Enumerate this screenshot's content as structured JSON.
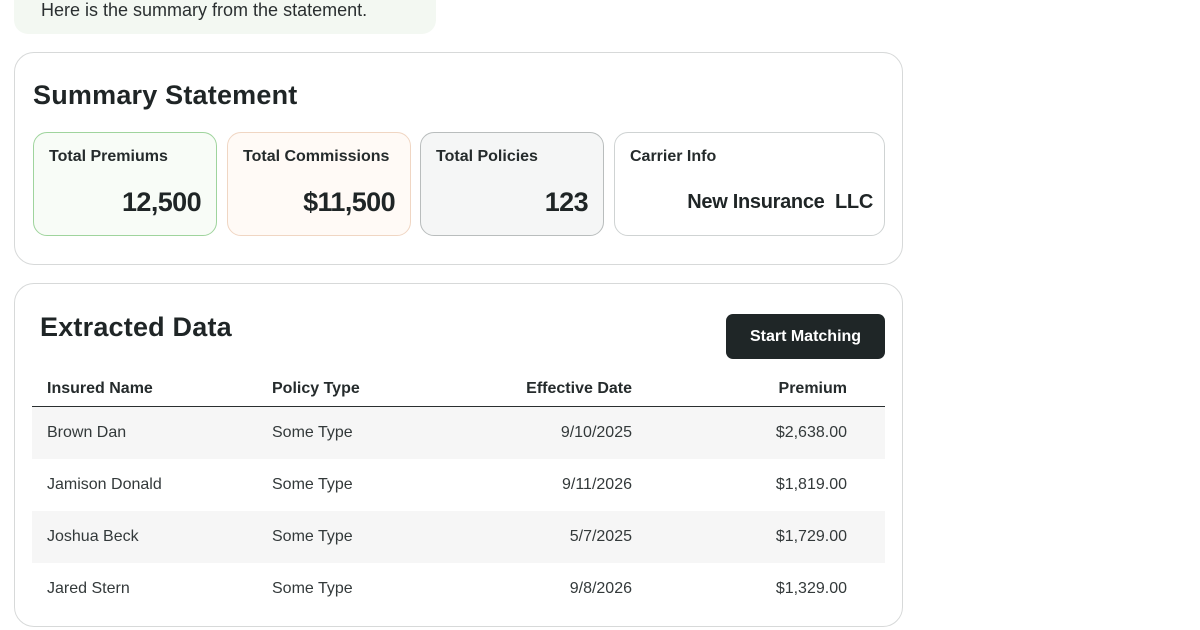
{
  "chat": {
    "message": "Here is the summary from the statement."
  },
  "summary": {
    "title": "Summary Statement",
    "stats": {
      "premiums": {
        "label": "Total Premiums",
        "value": "12,500"
      },
      "commissions": {
        "label": "Total Commissions",
        "value": "$11,500"
      },
      "policies": {
        "label": "Total Policies",
        "value": "123"
      },
      "carrier": {
        "label": "Carrier Info",
        "value": "New Insurance  LLC"
      }
    }
  },
  "extracted": {
    "title": "Extracted Data",
    "start_button": "Start Matching",
    "columns": {
      "name": "Insured Name",
      "type": "Policy Type",
      "date": "Effective Date",
      "premium": "Premium"
    },
    "rows": [
      {
        "name": "Brown Dan",
        "type": "Some Type",
        "date": "9/10/2025",
        "premium": "$2,638.00"
      },
      {
        "name": "Jamison Donald",
        "type": "Some Type",
        "date": "9/11/2026",
        "premium": "$1,819.00"
      },
      {
        "name": "Joshua Beck",
        "type": "Some Type",
        "date": "5/7/2025",
        "premium": "$1,729.00"
      },
      {
        "name": "Jared Stern",
        "type": "Some Type",
        "date": "9/8/2026",
        "premium": "$1,329.00"
      }
    ]
  },
  "colors": {
    "button_bg": "#1f2627",
    "premiums_border": "#9fd49d",
    "commissions_border": "#f0d6c3",
    "policies_border": "#b9bdbd",
    "chat_bg": "#f3f8f2"
  }
}
